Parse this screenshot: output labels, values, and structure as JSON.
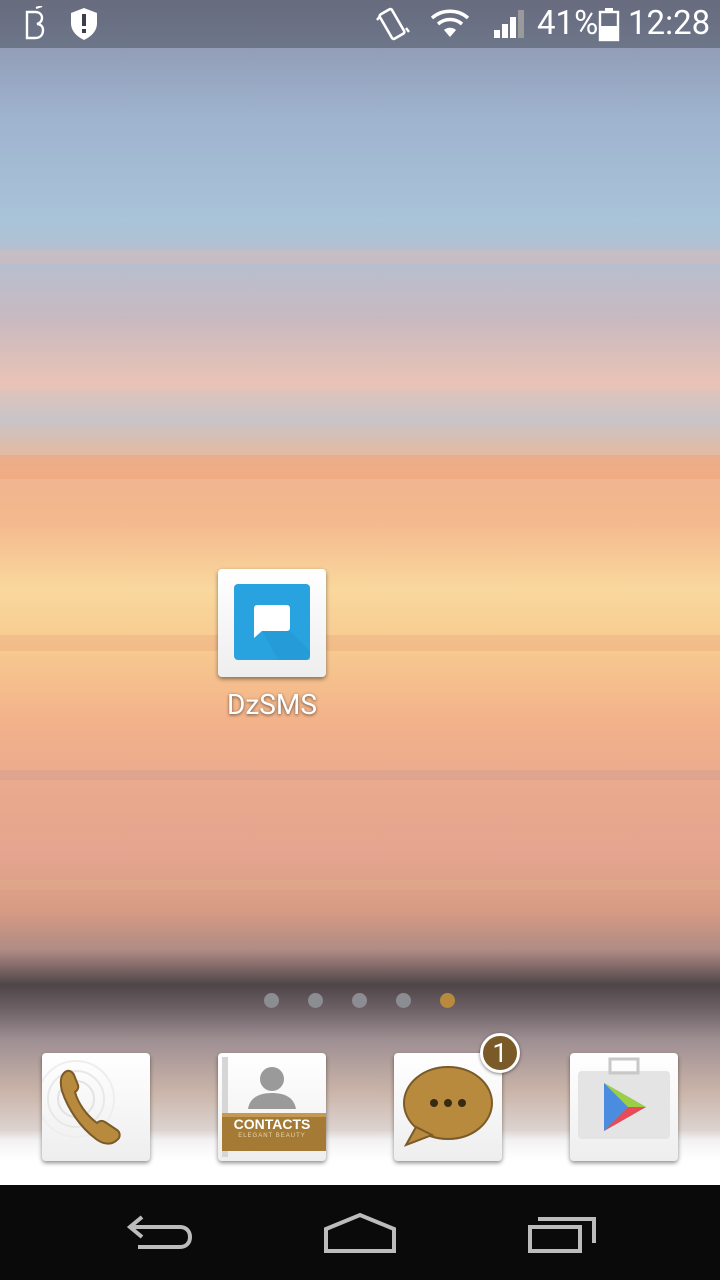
{
  "status_bar": {
    "icons": [
      "beats-audio-icon",
      "shield-alert-icon",
      "vibrate-icon",
      "wifi-icon",
      "signal-icon",
      "battery-icon"
    ],
    "battery_percent": "41%",
    "time": "12:28"
  },
  "home": {
    "apps": [
      {
        "name": "DzSMS",
        "icon": "chat-bubble-icon",
        "color": "#29a3e0"
      }
    ],
    "page_count": 5,
    "active_page": 5
  },
  "dock": {
    "apps": [
      {
        "icon": "phone-icon"
      },
      {
        "icon": "contacts-icon",
        "title": "CONTACTS",
        "subtitle": "ELEGANT BEAUTY"
      },
      {
        "icon": "messaging-icon",
        "badge": "1"
      },
      {
        "icon": "play-store-icon"
      }
    ]
  },
  "nav_bar": {
    "buttons": [
      "back-icon",
      "home-icon",
      "recent-apps-icon"
    ]
  },
  "colors": {
    "accent_gold": "#b88a3d",
    "dzsms_blue": "#29a3e0"
  }
}
